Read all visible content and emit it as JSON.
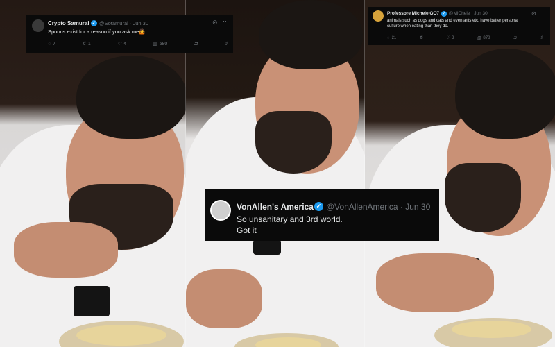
{
  "tweets": [
    {
      "id": "tweet-top-left",
      "author": "Crypto Samurai",
      "handle": "@Sotamurai",
      "date": "Jun 30",
      "text": "Spoons exist for a reason if you ask me🤷",
      "replies": "7",
      "retweets": "1",
      "likes": "4",
      "views": "580"
    },
    {
      "id": "tweet-top-right",
      "author": "Professore Michele GO7",
      "handle": "@MiChele",
      "date": "Jun 30",
      "text_lines": [
        "animals such as dogs and cats and even ants etc. have better personal",
        "culture when eating than they do."
      ],
      "replies": "21",
      "retweets": "",
      "likes": "3",
      "views": "878"
    },
    {
      "id": "tweet-center",
      "author": "VonAllen's America",
      "handle": "@VonAllenAmerica",
      "date": "Jun 30",
      "text_lines": [
        "So unsanitary and 3rd world.",
        "Got it"
      ]
    }
  ],
  "colors": {
    "verified_blue": "#1d9bf0",
    "tweet_bg": "#0a0a0a",
    "muted_text": "#71767b"
  }
}
